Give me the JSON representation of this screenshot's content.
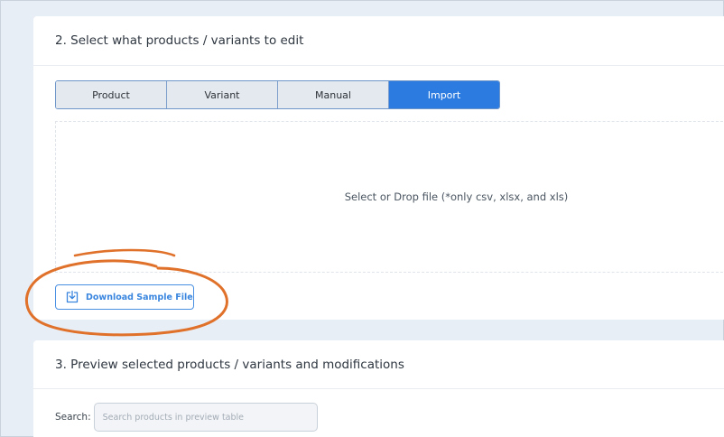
{
  "select_section": {
    "title": "2. Select what products / variants to edit",
    "tabs": [
      {
        "label": "Product",
        "active": false
      },
      {
        "label": "Variant",
        "active": false
      },
      {
        "label": "Manual",
        "active": false
      },
      {
        "label": "Import",
        "active": true
      }
    ],
    "dropzone_text": "Select or Drop file (*only csv, xlsx, and xls)",
    "download_button_label": "Download Sample File",
    "download_icon": "download-tray-icon",
    "highlight_color": "#e0712a"
  },
  "preview_section": {
    "title": "3. Preview selected products / variants and modifications",
    "search_label": "Search:",
    "search_placeholder": "Search products in preview table",
    "search_value": ""
  },
  "colors": {
    "accent": "#2c7be0",
    "page_bg": "#e8eef6",
    "link_blue": "#3a86df"
  }
}
